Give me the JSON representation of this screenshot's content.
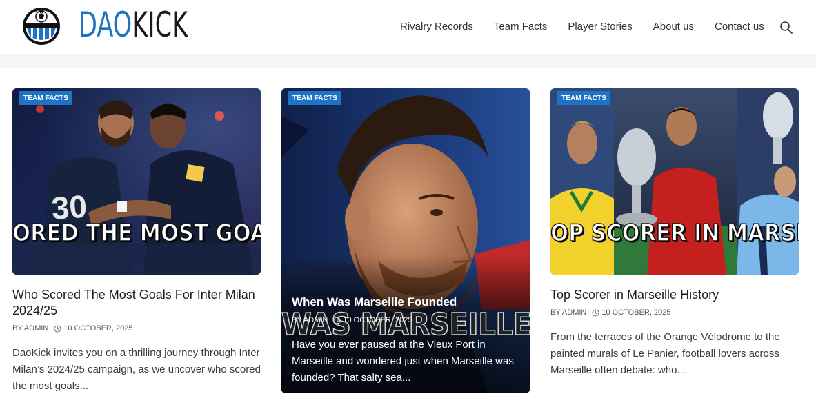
{
  "header": {
    "logo": {
      "part1": "DAO",
      "part2": "KICK"
    },
    "nav": [
      "Rivalry Records",
      "Team Facts",
      "Player Stories",
      "About us",
      "Contact us"
    ],
    "search_icon": "search-icon"
  },
  "colors": {
    "brand": "#1f73c4",
    "text": "#1e1e1e",
    "strip": "#f4f5f7"
  },
  "cards": [
    {
      "badge": "TEAM FACTS",
      "image_banner": "ORED THE MOST GOALS FOR INTER",
      "title": "Who Scored The Most Goals For Inter Milan 2024/25",
      "author": "BY ADMIN",
      "date": "10 OCTOBER, 2025",
      "excerpt": "DaoKick invites you on a thrilling journey through Inter Milan’s 2024/25 campaign, as we uncover who scored the most goals..."
    },
    {
      "badge": "TEAM FACTS",
      "image_banner": "WAS MARSEILLE FOU",
      "title": "When Was Marseille Founded",
      "author": "BY ADMIN",
      "date": "10 OCTOBER, 2025",
      "excerpt": "Have you ever paused at the Vieux Port in Marseille and wondered just when Marseille was founded? That salty sea..."
    },
    {
      "badge": "TEAM FACTS",
      "image_banner": "OP SCORER IN MARSEILLE HISTORY",
      "title": "Top Scorer in Marseille History",
      "author": "BY ADMIN",
      "date": "10 OCTOBER, 2025",
      "excerpt": "From the terraces of the Orange Vélodrome to the painted murals of Le Panier, football lovers across Marseille often debate: who..."
    }
  ]
}
